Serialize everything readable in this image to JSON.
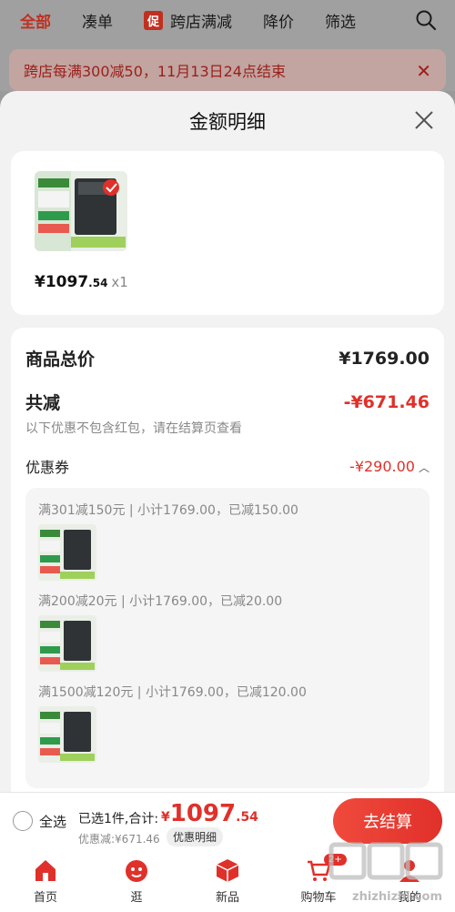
{
  "background": {
    "tabs": [
      "全部",
      "凑单",
      "跨店满减",
      "降价",
      "筛选"
    ],
    "promo_badge": "促",
    "banner_text": "跨店每满300减50，11月13日24点结束"
  },
  "sheet": {
    "title": "金额明细",
    "product": {
      "price_int": "¥1097",
      "price_dec": ".54",
      "qty": "x1"
    },
    "total_label": "商品总价",
    "total_value": "¥1769.00",
    "reduce_label": "共减",
    "reduce_value": "-¥671.46",
    "reduce_note": "以下优惠不包含红包，请在结算页查看",
    "coupon_label": "优惠券",
    "coupon_value": "-¥290.00",
    "coupons": [
      {
        "text": "满301减150元 | 小计1769.00，已减150.00"
      },
      {
        "text": "满200减20元 | 小计1769.00，已减20.00"
      },
      {
        "text": "满1500减120元 | 小计1769.00，已减120.00"
      }
    ]
  },
  "checkout": {
    "select_all": "全选",
    "selected_text": "已选1件,合计:",
    "sum_yen": "¥",
    "sum_int": "1097",
    "sum_dec": ".54",
    "discount_text": "优惠减:¥671.46",
    "detail_pill": "优惠明细",
    "button": "去结算"
  },
  "tabbar": {
    "items": [
      "首页",
      "逛",
      "新品",
      "购物车",
      "我的"
    ],
    "cart_badge": "2+"
  },
  "watermark": "zhizhizhi.com",
  "colors": {
    "accent": "#e0302a",
    "sheet_bg": "#f2f2f2"
  }
}
